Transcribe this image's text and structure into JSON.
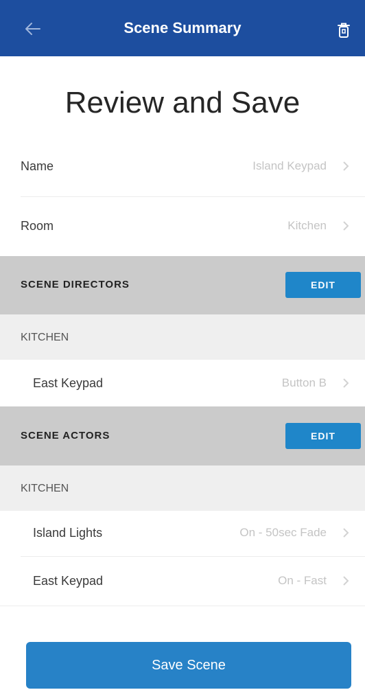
{
  "header": {
    "title": "Scene Summary",
    "back_icon": "back-arrow-icon",
    "delete_icon": "trash-icon",
    "color": "#1d4e9f"
  },
  "heading": "Review and Save",
  "fields": {
    "name": {
      "label": "Name",
      "value": "Island Keypad"
    },
    "room": {
      "label": "Room",
      "value": "Kitchen"
    }
  },
  "directors": {
    "title": "SCENE DIRECTORS",
    "edit_label": "EDIT",
    "room": "KITCHEN",
    "items": [
      {
        "label": "East Keypad",
        "value": "Button B"
      }
    ]
  },
  "actors": {
    "title": "SCENE ACTORS",
    "edit_label": "EDIT",
    "room": "KITCHEN",
    "items": [
      {
        "label": "Island Lights",
        "value": "On - 50sec Fade"
      },
      {
        "label": "East Keypad",
        "value": "On - Fast"
      }
    ]
  },
  "save_label": "Save Scene",
  "accent_color": "#2782c7"
}
